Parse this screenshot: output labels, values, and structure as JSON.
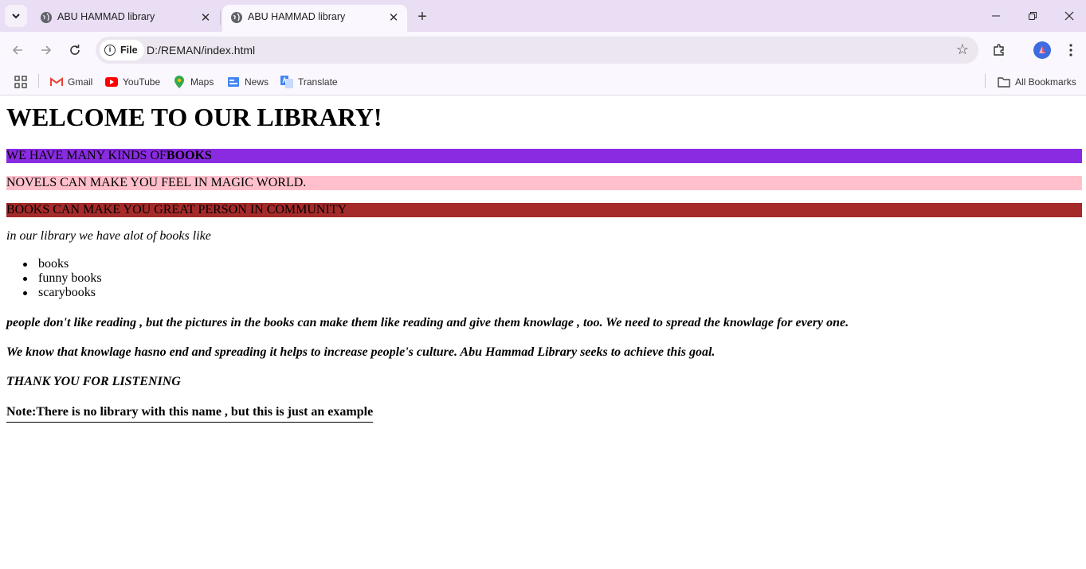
{
  "browser": {
    "tabs": [
      {
        "title": "ABU HAMMAD library",
        "active": false
      },
      {
        "title": "ABU HAMMAD library",
        "active": true
      }
    ],
    "address": {
      "scheme_chip": "File",
      "url": "D:/REMAN/index.html"
    },
    "bookmarks": [
      {
        "label": "Gmail",
        "icon": "gmail-icon"
      },
      {
        "label": "YouTube",
        "icon": "youtube-icon"
      },
      {
        "label": "Maps",
        "icon": "maps-icon"
      },
      {
        "label": "News",
        "icon": "news-icon"
      },
      {
        "label": "Translate",
        "icon": "translate-icon"
      }
    ],
    "all_bookmarks": "All Bookmarks",
    "colors": {
      "tabstrip": "#e9def3",
      "toolbar": "#fbf7fe",
      "omnibox": "#ece6f0"
    }
  },
  "page": {
    "heading": "WELCOME TO OUR LIBRARY!",
    "band1": {
      "text": "WE HAVE MANY KINDS OF",
      "bold": "BOOKS",
      "color": "#8a2be2"
    },
    "band2": {
      "text": "NOVELS CAN MAKE YOU FEEL IN MAGIC WORLD.",
      "color": "#ffc0cb"
    },
    "band3": {
      "text": "BOOKS CAN MAKE YOU GREAT PERSON IN COMMUNITY",
      "color": "#a52a2a"
    },
    "intro": "in our library we have alot of books like",
    "list": [
      "books",
      "funny books",
      "scarybooks"
    ],
    "paragraph1": "people don't like reading , but the pictures in the books can make them like reading and give them knowlage , too. We need to spread the knowlage for every one.",
    "paragraph2": "We know that knowlage hasno end and spreading it helps to increase people's culture. Abu Hammad Library seeks to achieve this goal.",
    "thanks": "THANK YOU FOR LISTENING",
    "note": "Note:There is no library with this name , but this is just an example"
  }
}
